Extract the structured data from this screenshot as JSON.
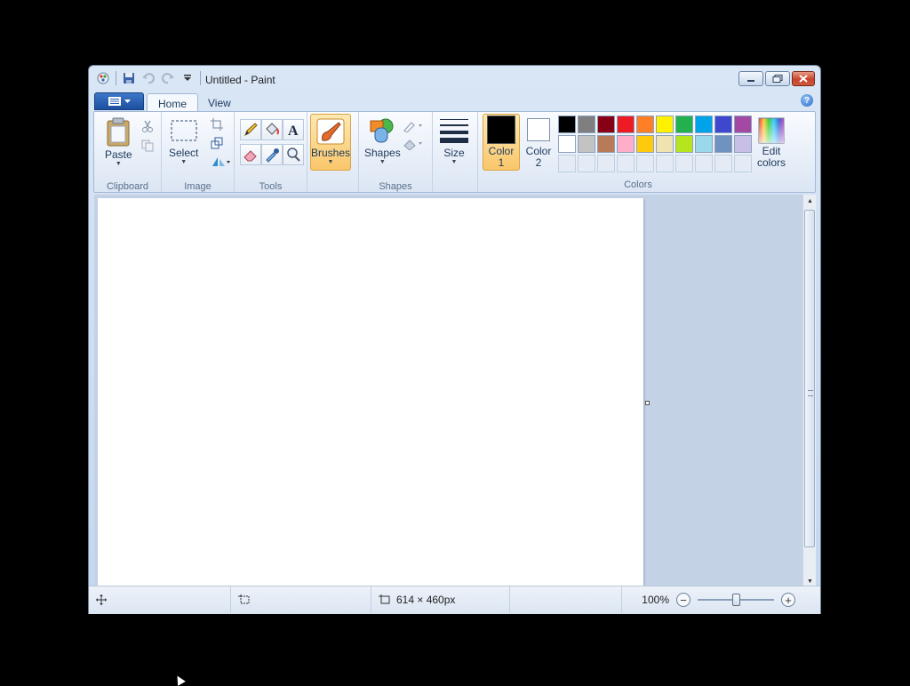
{
  "window": {
    "title": "Untitled - Paint",
    "buttons": {
      "minimize": "minimize",
      "maximize": "maximize",
      "close": "close"
    }
  },
  "quick_access": {
    "icons": [
      "paint-app-icon",
      "save-icon",
      "undo-icon",
      "redo-icon",
      "customize-qat-icon"
    ]
  },
  "tabs": [
    {
      "label": "Home",
      "active": true
    },
    {
      "label": "View",
      "active": false
    }
  ],
  "ribbon": {
    "clipboard": {
      "group_label": "Clipboard",
      "paste_label": "Paste"
    },
    "image": {
      "group_label": "Image",
      "select_label": "Select"
    },
    "tools": {
      "group_label": "Tools"
    },
    "brushes": {
      "label": "Brushes"
    },
    "shapes": {
      "group_label": "Shapes",
      "shapes_label": "Shapes"
    },
    "size": {
      "label": "Size"
    },
    "colors": {
      "group_label": "Colors",
      "color1_label": "Color",
      "color1_num": "1",
      "color2_label": "Color",
      "color2_num": "2",
      "color1_value": "#000000",
      "color2_value": "#ffffff",
      "edit_label": "Edit",
      "edit_label2": "colors",
      "palette_row1": [
        "#000000",
        "#7f7f7f",
        "#880015",
        "#ed1c24",
        "#ff7f27",
        "#fff200",
        "#22b14c",
        "#00a2e8",
        "#3f48cc",
        "#a349a4"
      ],
      "palette_row2": [
        "#ffffff",
        "#c3c3c3",
        "#b97a57",
        "#ffaec9",
        "#ffc90e",
        "#efe4b0",
        "#b5e61d",
        "#99d9ea",
        "#7092be",
        "#c8bfe7"
      ]
    }
  },
  "status": {
    "dimensions": "614 × 460px",
    "zoom": "100%"
  }
}
